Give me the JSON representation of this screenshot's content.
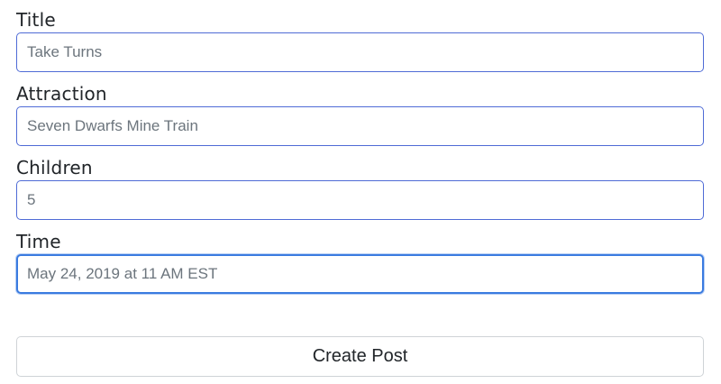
{
  "form": {
    "fields": [
      {
        "label": "Title",
        "placeholder": "Take Turns"
      },
      {
        "label": "Attraction",
        "placeholder": "Seven Dwarfs Mine Train"
      },
      {
        "label": "Children",
        "placeholder": "5"
      },
      {
        "label": "Time",
        "placeholder": "May 24, 2019 at 11 AM EST"
      }
    ],
    "submit_label": "Create Post"
  },
  "colors": {
    "input_border": "#4f6bd6",
    "focus_border": "#3a7be0",
    "placeholder_text": "#6c757d",
    "button_border": "#cfd3d7"
  }
}
